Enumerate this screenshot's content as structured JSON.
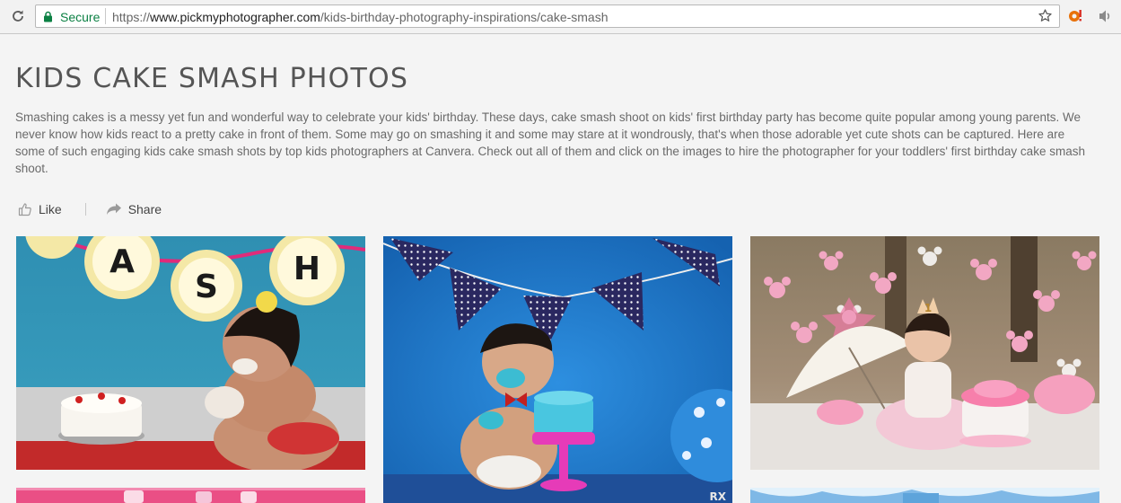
{
  "browser": {
    "secure_label": "Secure",
    "url_scheme": "https://",
    "url_host": "www.pickmyphotographer.com",
    "url_path": "/kids-birthday-photography-inspirations/cake-smash"
  },
  "page": {
    "title": "KIDS CAKE SMASH PHOTOS",
    "description": "Smashing cakes is a messy yet fun and wonderful way to celebrate your kids' birthday. These days, cake smash shoot on kids' first birthday party has become quite popular among young parents. We never know how kids react to a pretty cake in front of them. Some may go on smashing it and some may stare at it wondrously, that's when those adorable yet cute shots can be captured. Here are some of such engaging kids cake smash shots by top kids photographers at Canvera. Check out all of them and click on the images to hire the photographer for your toddlers' first birthday cake smash shoot."
  },
  "actions": {
    "like_label": "Like",
    "share_label": "Share"
  },
  "gallery": {
    "photo1_plates": [
      "A",
      "S",
      "H"
    ],
    "photo3_crown": "1",
    "photo2_watermark": "RX"
  },
  "colors": {
    "secure_green": "#0b8043",
    "title_gray": "#555555",
    "text_gray": "#6a6a6a",
    "icon_gray": "#9a9a9a"
  },
  "icons": [
    "reload-icon",
    "lock-icon",
    "star-icon",
    "extension-icon",
    "speaker-icon",
    "thumbs-up-icon",
    "share-arrow-icon"
  ]
}
